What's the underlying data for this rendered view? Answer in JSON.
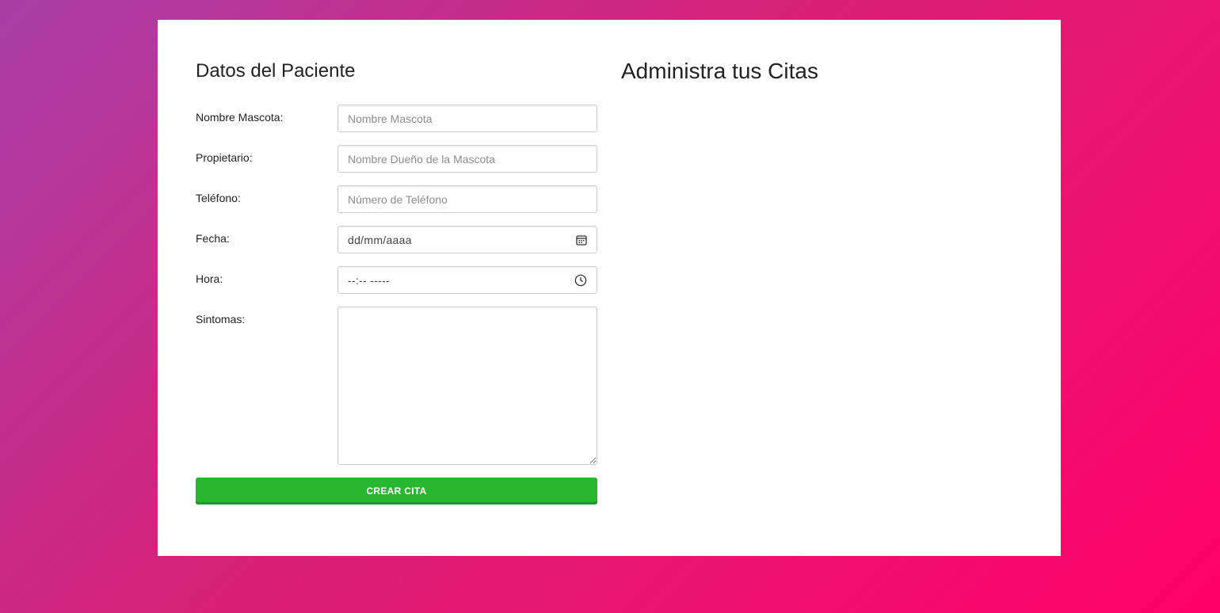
{
  "form": {
    "title": "Datos del Paciente",
    "fields": {
      "mascota": {
        "label": "Nombre Mascota:",
        "placeholder": "Nombre Mascota"
      },
      "propietario": {
        "label": "Propietario:",
        "placeholder": "Nombre Dueño de la Mascota"
      },
      "telefono": {
        "label": "Teléfono:",
        "placeholder": "Número de Teléfono"
      },
      "fecha": {
        "label": "Fecha:",
        "value": "dd/mm/aaaa",
        "icon": "calendar-icon"
      },
      "hora": {
        "label": "Hora:",
        "value": "--:-- -----",
        "icon": "clock-icon"
      },
      "sintomas": {
        "label": "Sintomas:"
      }
    },
    "submit_label": "CREAR CITA",
    "submit_color": "#27b82f"
  },
  "list": {
    "title": "Administra tus Citas"
  }
}
